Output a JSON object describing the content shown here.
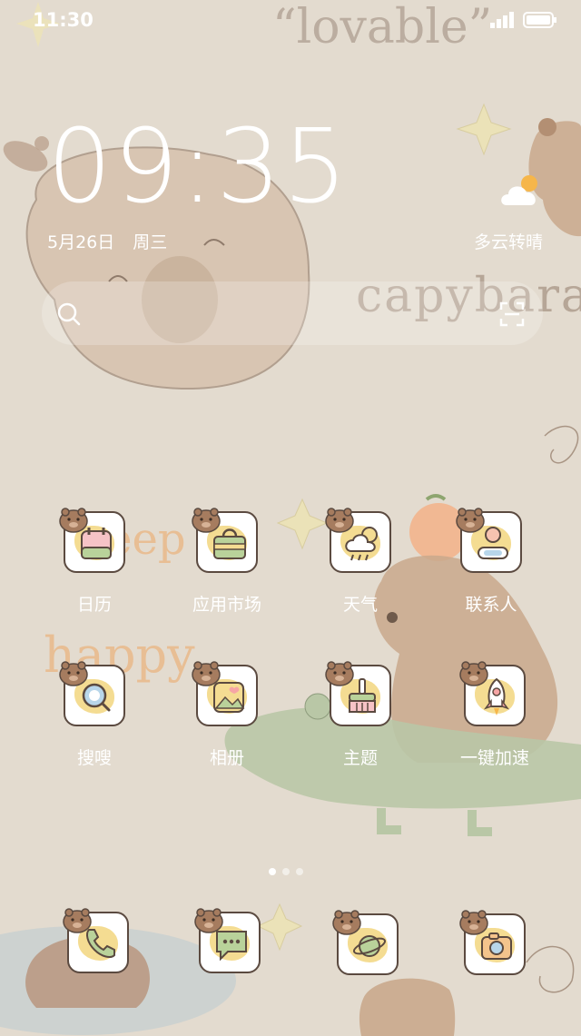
{
  "status_bar": {
    "time": "11:30"
  },
  "wallpaper": {
    "texts": [
      "“lovable”",
      "capybara",
      "keep",
      "happy"
    ]
  },
  "clock_widget": {
    "time": "09:35",
    "date": "5月26日",
    "weekday": "周三",
    "weather": "多云转晴",
    "weather_icon": "cloud-sun-icon"
  },
  "search_bar": {
    "search_icon": "search-icon",
    "scan_icon": "scan-icon"
  },
  "apps": [
    {
      "label": "日历",
      "icon": "calendar-icon"
    },
    {
      "label": "应用市场",
      "icon": "shopping-bag-icon"
    },
    {
      "label": "天气",
      "icon": "weather-icon"
    },
    {
      "label": "联系人",
      "icon": "contact-icon"
    },
    {
      "label": "搜嗖",
      "icon": "search-icon"
    },
    {
      "label": "相册",
      "icon": "gallery-icon"
    },
    {
      "label": "主题",
      "icon": "brush-icon"
    },
    {
      "label": "一键加速",
      "icon": "rocket-icon"
    }
  ],
  "dock": [
    {
      "icon": "phone-icon"
    },
    {
      "icon": "message-icon"
    },
    {
      "icon": "planet-icon"
    },
    {
      "icon": "camera-icon"
    }
  ],
  "page_indicator": {
    "count": 3,
    "active": 1
  },
  "colors": {
    "background": "#e3dbcf",
    "tile_border": "#5b4a40",
    "accent_yellow": "#f4dc92",
    "capybara": "#c9a88c"
  }
}
